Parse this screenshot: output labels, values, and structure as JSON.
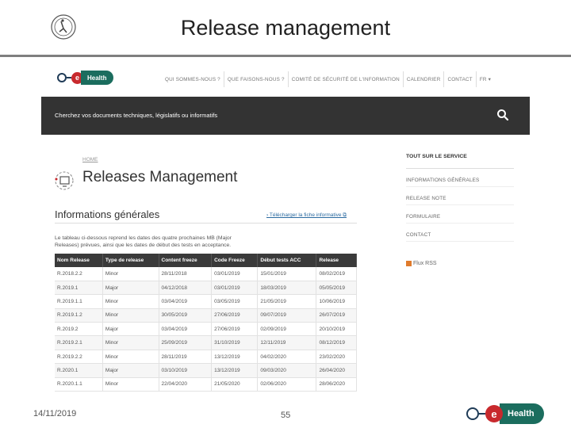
{
  "slide": {
    "title": "Release management",
    "date": "14/11/2019",
    "page_number": "55",
    "logo_letter": "e",
    "logo_text": "Health"
  },
  "site": {
    "brand_letter": "e",
    "brand_text": "Health",
    "nav": [
      "QUI SOMMES-NOUS ?",
      "QUE FAISONS-NOUS ?",
      "COMITÉ DE SÉCURITÉ DE L'INFORMATION",
      "CALENDRIER",
      "CONTACT",
      "FR ▾"
    ],
    "search_prompt": "Cherchez vos documents techniques, législatifs ou informatifs",
    "breadcrumb": "HOME",
    "page_title": "Releases Management",
    "section_title": "Informations générales",
    "download_link": "› Télécharger la fiche informative ⧉",
    "intro": "Le tableau ci-dessous reprend les dates des quatre prochaines MB (Major Releases) prévues, ainsi que les dates de début des tests en acceptance.",
    "table": {
      "headers": [
        "Nom Release",
        "Type de release",
        "Content freeze",
        "Code Freeze",
        "Début tests ACC",
        "Release"
      ],
      "rows": [
        [
          "R.2018.2.2",
          "Minor",
          "28/11/2018",
          "03/01/2019",
          "15/01/2019",
          "08/02/2019"
        ],
        [
          "R.2019.1",
          "Major",
          "04/12/2018",
          "03/01/2019",
          "18/03/2019",
          "05/05/2019"
        ],
        [
          "R.2019.1.1",
          "Minor",
          "03/04/2019",
          "03/05/2019",
          "21/05/2019",
          "10/06/2019"
        ],
        [
          "R.2019.1.2",
          "Minor",
          "30/05/2019",
          "27/06/2019",
          "09/07/2019",
          "26/07/2019"
        ],
        [
          "R.2019.2",
          "Major",
          "03/04/2019",
          "27/06/2019",
          "02/09/2019",
          "20/10/2019"
        ],
        [
          "R.2019.2.1",
          "Minor",
          "25/09/2019",
          "31/10/2019",
          "12/11/2019",
          "08/12/2019"
        ],
        [
          "R.2019.2.2",
          "Minor",
          "28/11/2019",
          "13/12/2019",
          "04/02/2020",
          "23/02/2020"
        ],
        [
          "R.2020.1",
          "Major",
          "03/10/2019",
          "13/12/2019",
          "09/03/2020",
          "26/04/2020"
        ],
        [
          "R.2020.1.1",
          "Minor",
          "22/04/2020",
          "21/05/2020",
          "02/06/2020",
          "28/06/2020"
        ]
      ]
    },
    "sidebar": {
      "heading": "TOUT SUR LE SERVICE",
      "items": [
        "INFORMATIONS GÉNÉRALES",
        "RELEASE NOTE",
        "FORMULAIRE",
        "CONTACT"
      ],
      "rss_label": "Flux RSS"
    }
  },
  "colors": {
    "brand_red": "#c8292d",
    "brand_green": "#1b6d5e",
    "dark_bar": "#333333"
  }
}
